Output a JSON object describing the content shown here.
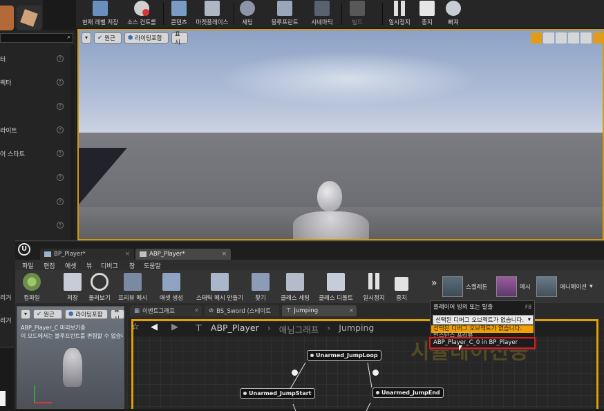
{
  "main_toolbar": {
    "buttons": [
      {
        "label": "현재 레벨 저장",
        "icon": "save-icon"
      },
      {
        "label": "소스 컨트롤",
        "icon": "source-control-icon"
      },
      {
        "label": "콘텐츠",
        "icon": "content-icon"
      },
      {
        "label": "마켓플레이스",
        "icon": "marketplace-icon"
      },
      {
        "label": "세팅",
        "icon": "settings-icon"
      },
      {
        "label": "블루프린트",
        "icon": "blueprint-icon"
      },
      {
        "label": "시네마틱",
        "icon": "cinematic-icon"
      },
      {
        "label": "빌드",
        "icon": "build-icon"
      },
      {
        "label": "일시정지",
        "icon": "pause-icon"
      },
      {
        "label": "중지",
        "icon": "stop-icon"
      },
      {
        "label": "빠져",
        "icon": "eject-icon"
      }
    ]
  },
  "left_panel": {
    "items": [
      "터",
      "렉터",
      "",
      "라이트",
      "어 스타트",
      "",
      "",
      "",
      "",
      "",
      "리거",
      "리거"
    ]
  },
  "viewport": {
    "perspective": "원근",
    "lighting": "라이팅포함",
    "show": "표시"
  },
  "bp_window": {
    "tabs": [
      "BP_Player*",
      "ABP_Player*"
    ],
    "menu": [
      "파일",
      "편집",
      "애셋",
      "뷰",
      "디버그",
      "창",
      "도움말"
    ],
    "toolbar": [
      {
        "label": "컴파일",
        "icon": "compile-icon"
      },
      {
        "label": "저장",
        "icon": "save-icon"
      },
      {
        "label": "둘러보기",
        "icon": "browse-icon"
      },
      {
        "label": "프리뷰 메시",
        "icon": "preview-mesh-icon"
      },
      {
        "label": "애셋 생성",
        "icon": "create-asset-icon"
      },
      {
        "label": "스태틱 메시 만들기",
        "icon": "static-mesh-icon"
      },
      {
        "label": "찾기",
        "icon": "find-icon"
      },
      {
        "label": "클래스 세팅",
        "icon": "class-settings-icon"
      },
      {
        "label": "클래스 디폴트",
        "icon": "class-defaults-icon"
      },
      {
        "label": "일시정지",
        "icon": "pause-icon"
      },
      {
        "label": "중지",
        "icon": "stop-icon"
      }
    ],
    "mode_buttons": [
      "스켈레톤",
      "메시",
      "애니메이션"
    ],
    "preview": {
      "perspective": "원근",
      "lighting": "라이팅포함",
      "show": "표시",
      "line1": "ABP_Player_C 미리보기중",
      "line2": "이 모드에서는 블루프린트를 편집할 수 없습니다"
    },
    "graph_tabs": [
      "이벤트그래프",
      "BS_Sword (스테이트",
      "Jumping"
    ],
    "breadcrumb": {
      "root": "ABP_Player",
      "mid": "애님그래프",
      "leaf": "Jumping"
    },
    "watermark": "시뮬레이션중",
    "nodes": [
      "Unarmed_JumpLoop",
      "Unarmed_JumpStart",
      "Unarmed_JumpEnd"
    ]
  },
  "debug_dropdown": {
    "header": "플레이어 빙의 또는 탈출",
    "shortcut": "F8",
    "select_value": "선택된 디버그 오브젝트가 없습니다.",
    "highlighted": "선택된 디버그 오브젝트가 없습니다.",
    "section": "인스턴스 프리뷰",
    "option": "ABP_Player_C_0 in BP_Player"
  },
  "colors": {
    "accent": "#e8a800",
    "highlight": "#e11b1b",
    "selected": "#f0a000"
  }
}
